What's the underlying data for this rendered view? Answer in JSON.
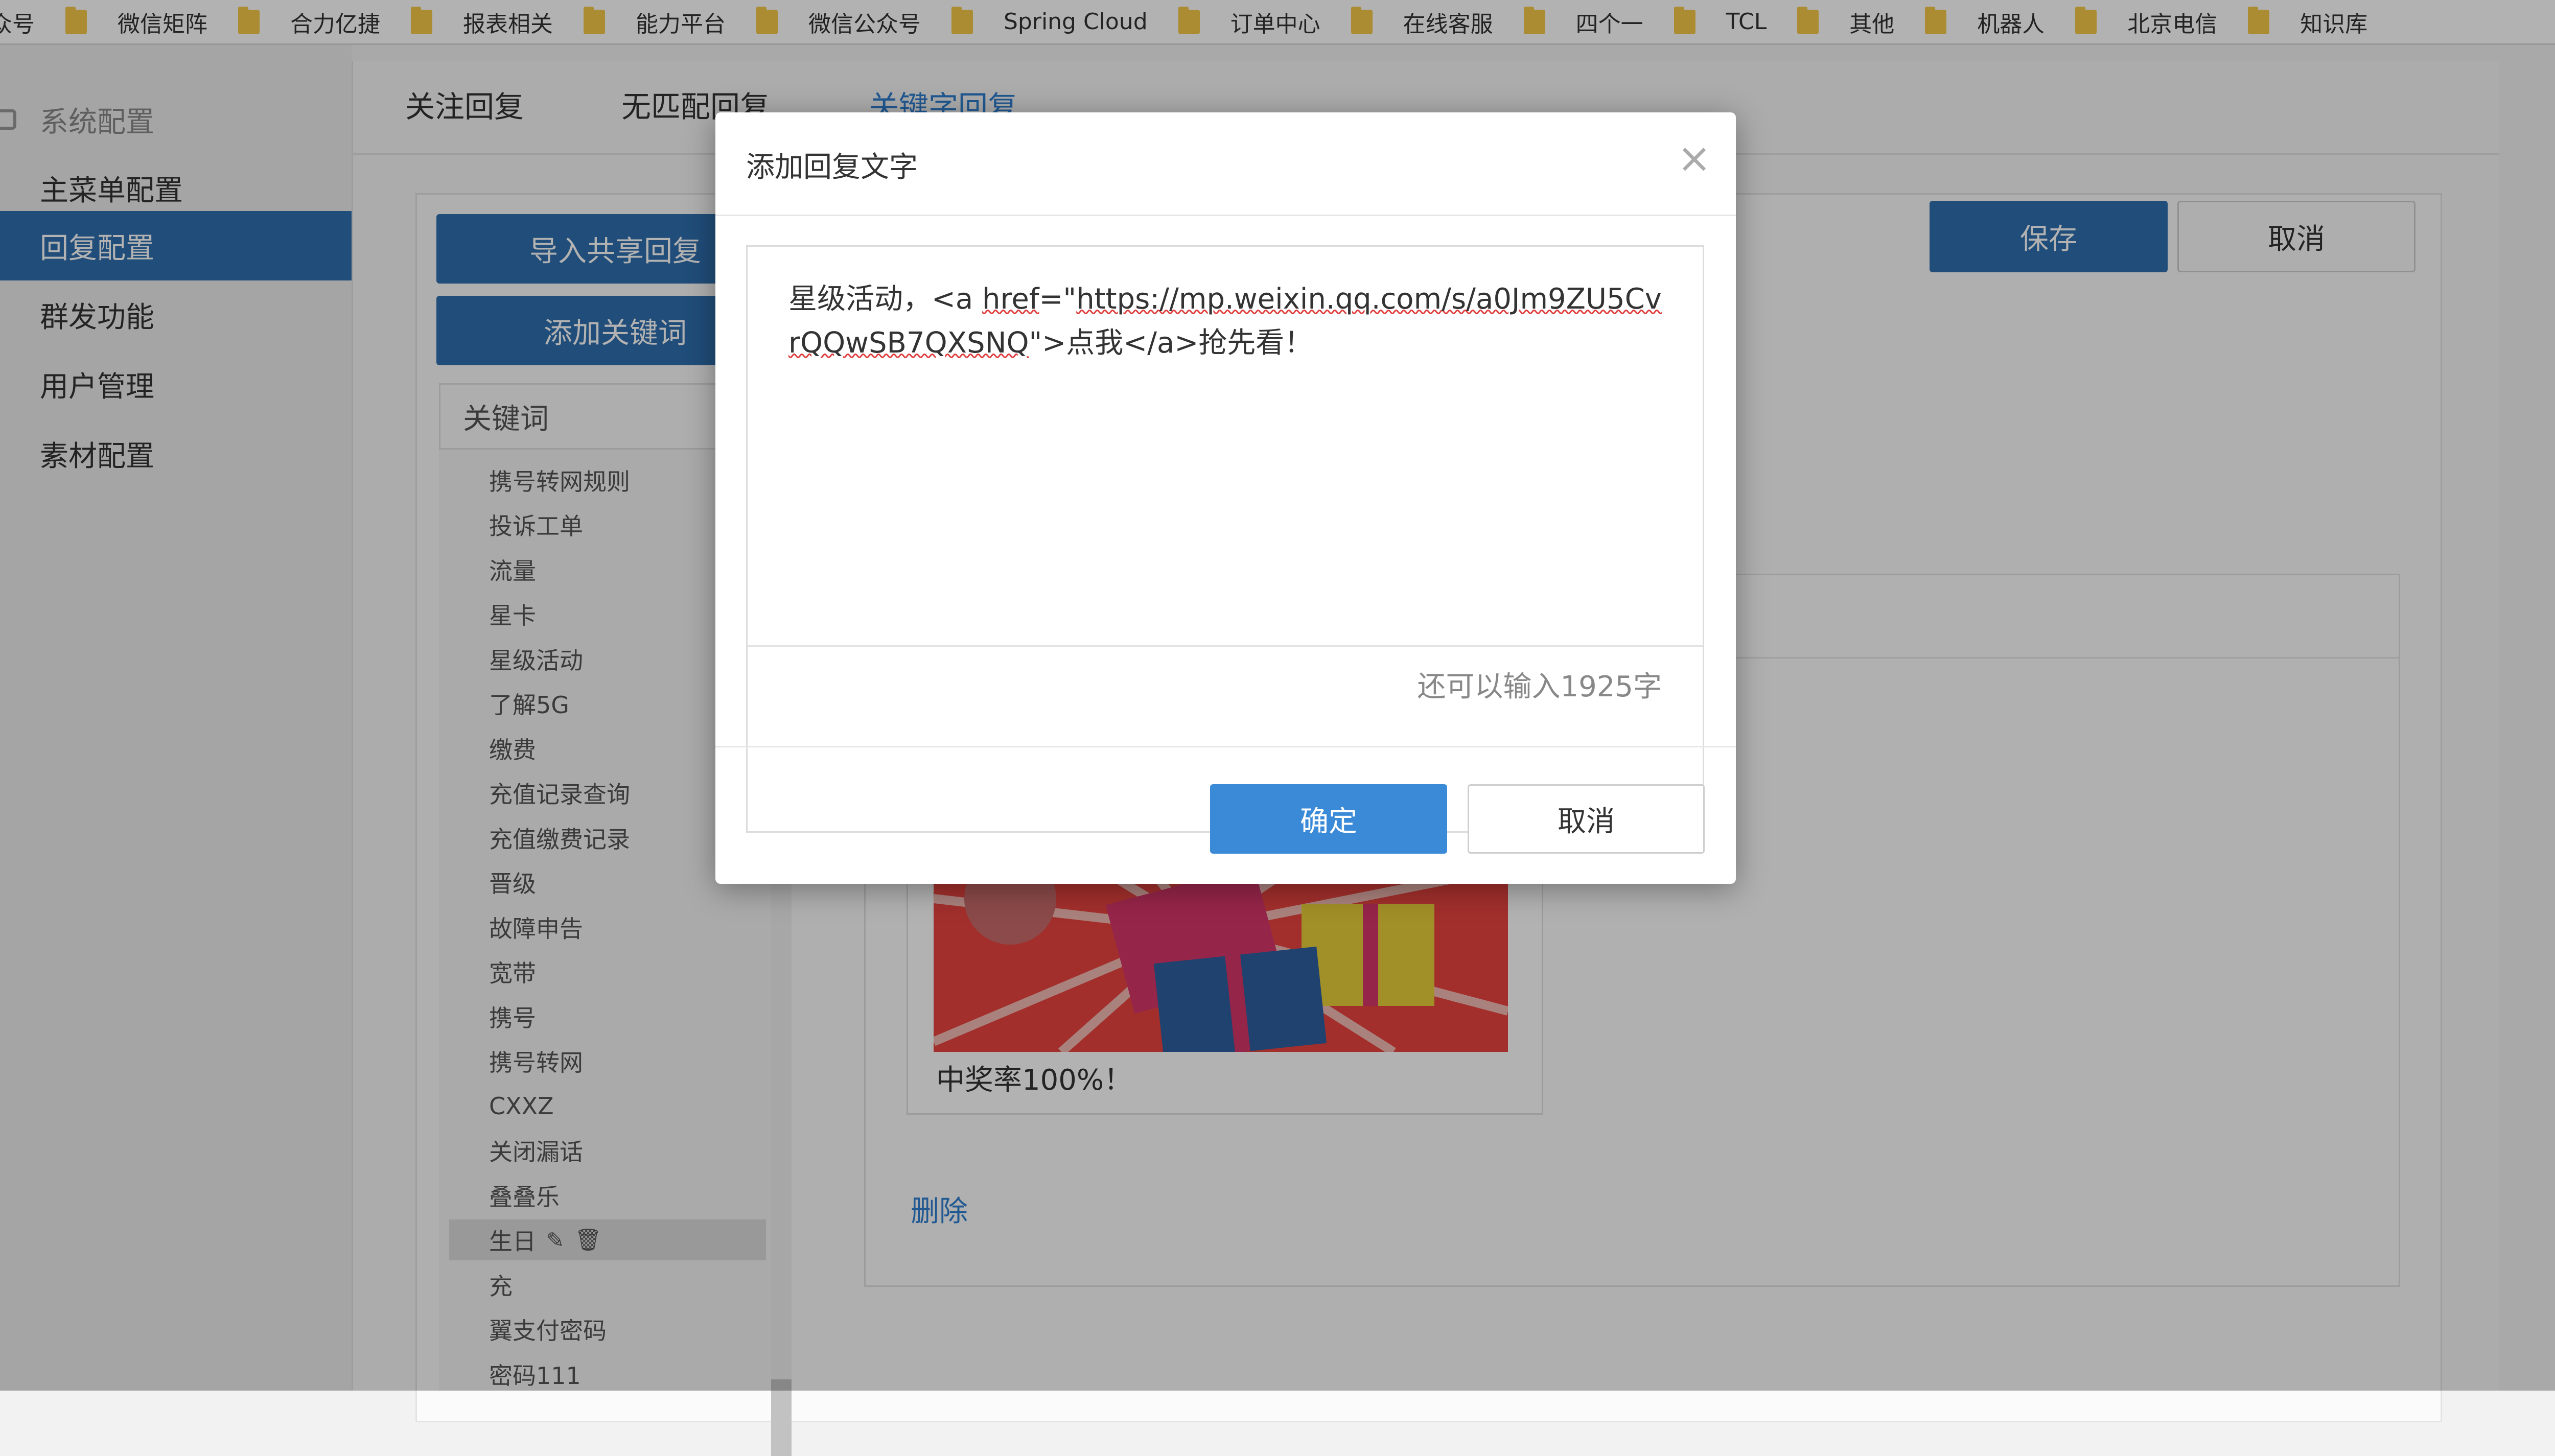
{
  "bookmarks": {
    "items": [
      "众号",
      "微信矩阵",
      "合力亿捷",
      "报表相关",
      "能力平台",
      "微信公众号",
      "Spring Cloud",
      "订单中心",
      "在线客服",
      "四个一",
      "TCL",
      "其他",
      "机器人",
      "北京电信",
      "知识库"
    ],
    "more": "»"
  },
  "sidebar": {
    "items": [
      {
        "label": "系统配置"
      },
      {
        "label": "主菜单配置"
      },
      {
        "label": "回复配置"
      },
      {
        "label": "群发功能"
      },
      {
        "label": "用户管理"
      },
      {
        "label": "素材配置"
      }
    ]
  },
  "main": {
    "tabs": [
      "关注回复",
      "无匹配回复",
      "关键字回复"
    ],
    "import_label": "导入共享回复",
    "add_keyword_label": "添加关键词",
    "save_label": "保存",
    "cancel_label": "取消",
    "keyword_header": "关键词",
    "keywords": [
      "携号转网规则",
      "投诉工单",
      "流量",
      "星卡",
      "星级活动",
      "了解5G",
      "缴费",
      "充值记录查询",
      "充值缴费记录",
      "晋级",
      "故障申告",
      "宽带",
      "携号",
      "携号转网",
      "CXXZ",
      "关闭漏话",
      "叠叠乐",
      "生日",
      "充",
      "翼支付密码",
      "密码111"
    ],
    "card_caption": "中奖率100%！",
    "delete_label": "删除"
  },
  "modal": {
    "title": "添加回复文字",
    "close": "×",
    "text_prefix": "星级活动，<a ",
    "text_href": "href",
    "text_eq": "=\"",
    "text_url": "https://mp.weixin.qq.com/s/a0Jm9ZU5CvrQQwSB7QXSNQ",
    "text_suffix": "\">点我</a>抢先看！",
    "counter": "还可以输入1925字",
    "confirm_label": "确定",
    "cancel_label": "取消"
  },
  "colors": {
    "primary": "#2f6fae",
    "accent_link": "#2f7fd0",
    "confirm": "#3a8ad8"
  }
}
